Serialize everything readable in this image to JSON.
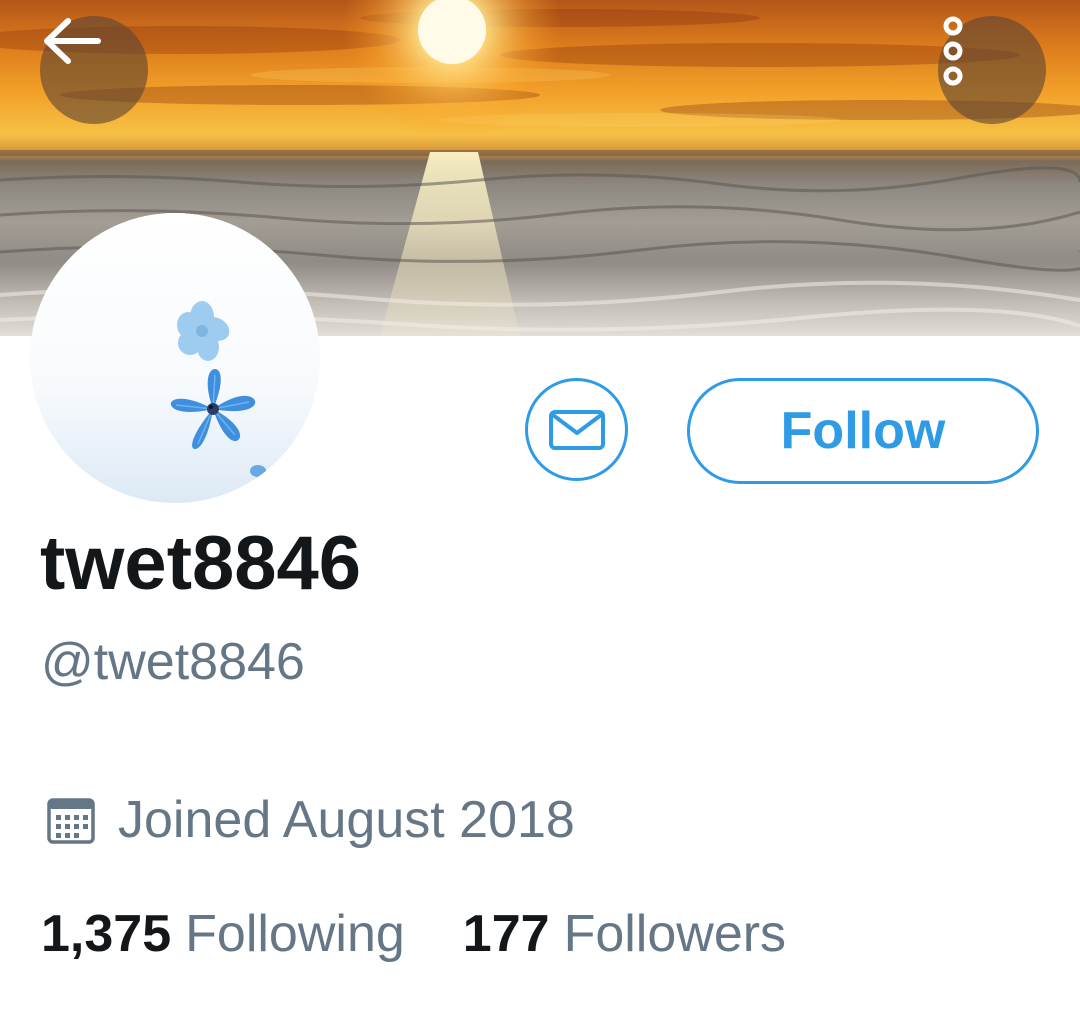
{
  "header": {
    "back_icon": "arrow-left-icon",
    "more_icon": "more-vertical-icon"
  },
  "profile": {
    "display_name": "twet8846",
    "handle": "@twet8846",
    "joined_icon": "calendar-icon",
    "joined_text": "Joined August 2018"
  },
  "actions": {
    "message_icon": "envelope-icon",
    "follow_label": "Follow"
  },
  "stats": {
    "following_count": "1,375",
    "following_label": "Following",
    "followers_count": "177",
    "followers_label": "Followers"
  },
  "colors": {
    "accent": "#2f9be5",
    "text_primary": "#14171a",
    "text_secondary": "#657786"
  }
}
